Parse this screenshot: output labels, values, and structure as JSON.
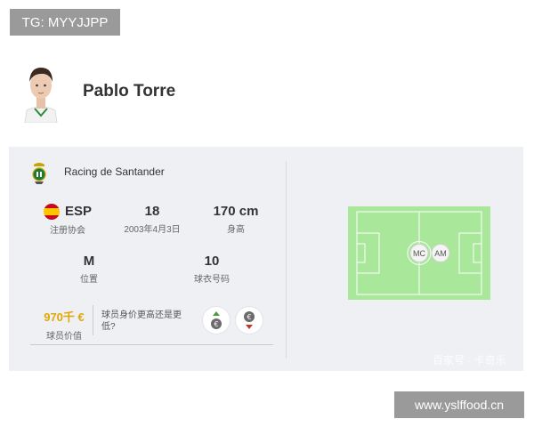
{
  "watermark_top": "TG: MYYJJPP",
  "player": {
    "name": "Pablo Torre"
  },
  "club": {
    "name": "Racing de Santander"
  },
  "stats": {
    "nationality": {
      "value": "ESP",
      "label": "注册协会"
    },
    "age": {
      "value": "18",
      "label": "2003年4月3日"
    },
    "height": {
      "value": "170 cm",
      "label": "身高"
    },
    "foot": {
      "value": "M",
      "label": "位置"
    },
    "shirt": {
      "value": "10",
      "label": "球衣号码"
    }
  },
  "market": {
    "value": "970千 €",
    "label": "球员价值",
    "question": "球员身价更高还是更低?"
  },
  "vote": {
    "up_icon": "euro-up-icon",
    "down_icon": "euro-down-icon"
  },
  "positions": [
    "MC",
    "AM"
  ],
  "watermark_faint": "百家号 · 卡奇乐",
  "site_badge": "www.yslffood.cn",
  "colors": {
    "pitch": "#a9e79a",
    "pitch_line": "#ffffff",
    "market_value": "#e0a800",
    "flag_red": "#c60b1e",
    "flag_yellow": "#ffc400"
  }
}
